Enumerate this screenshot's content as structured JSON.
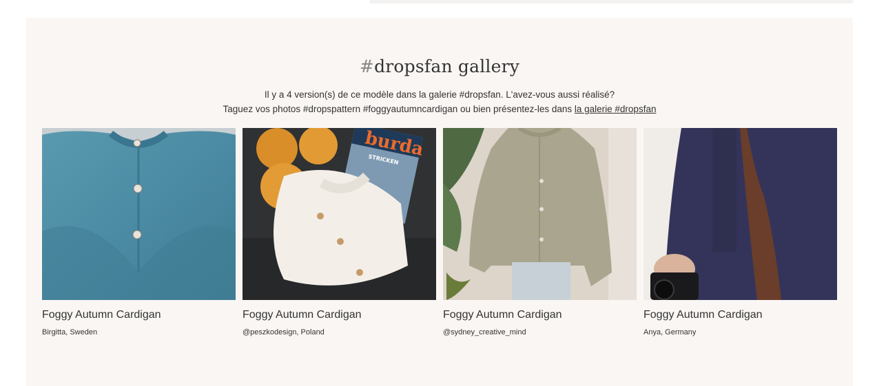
{
  "gallery": {
    "title_hash": "#",
    "title_text": "dropsfan gallery",
    "intro_line1": "Il y a 4 version(s) de ce modèle dans la galerie #dropsfan. L'avez-vous aussi réalisé?",
    "intro_line2_prefix": "Taguez vos photos #dropspattern #foggyautumncardigan ou bien présentez-les dans ",
    "intro_link": "la galerie #dropsfan"
  },
  "cards": [
    {
      "name": "Foggy Autumn Cardigan",
      "author": "Birgitta, Sweden"
    },
    {
      "name": "Foggy Autumn Cardigan",
      "author": "@peszkodesign, Poland"
    },
    {
      "name": "Foggy Autumn Cardigan",
      "author": "@sydney_creative_mind"
    },
    {
      "name": "Foggy Autumn Cardigan",
      "author": "Anya, Germany"
    }
  ],
  "photo_content": {
    "magazine_logo": "burda",
    "magazine_subtitle": "STRICKEN"
  },
  "colors": {
    "section_background": "#faf6f3",
    "text": "#333333"
  }
}
